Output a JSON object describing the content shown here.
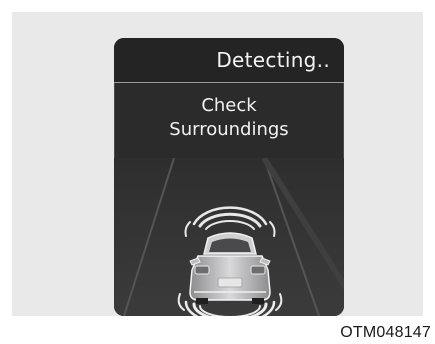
{
  "cluster_display": {
    "status": "Detecting..",
    "message_line1": "Check",
    "message_line2": "Surroundings",
    "icons": {
      "vehicle": "car-rear-view-icon",
      "front_sensor": "front-sensor-waves-icon",
      "rear_sensor": "rear-sensor-waves-icon"
    },
    "colors": {
      "screen": "#2b2b2c",
      "text": "#f2f2f2",
      "sensor_arcs": "#e8e8e8"
    }
  },
  "figure_code": "OTM048147"
}
